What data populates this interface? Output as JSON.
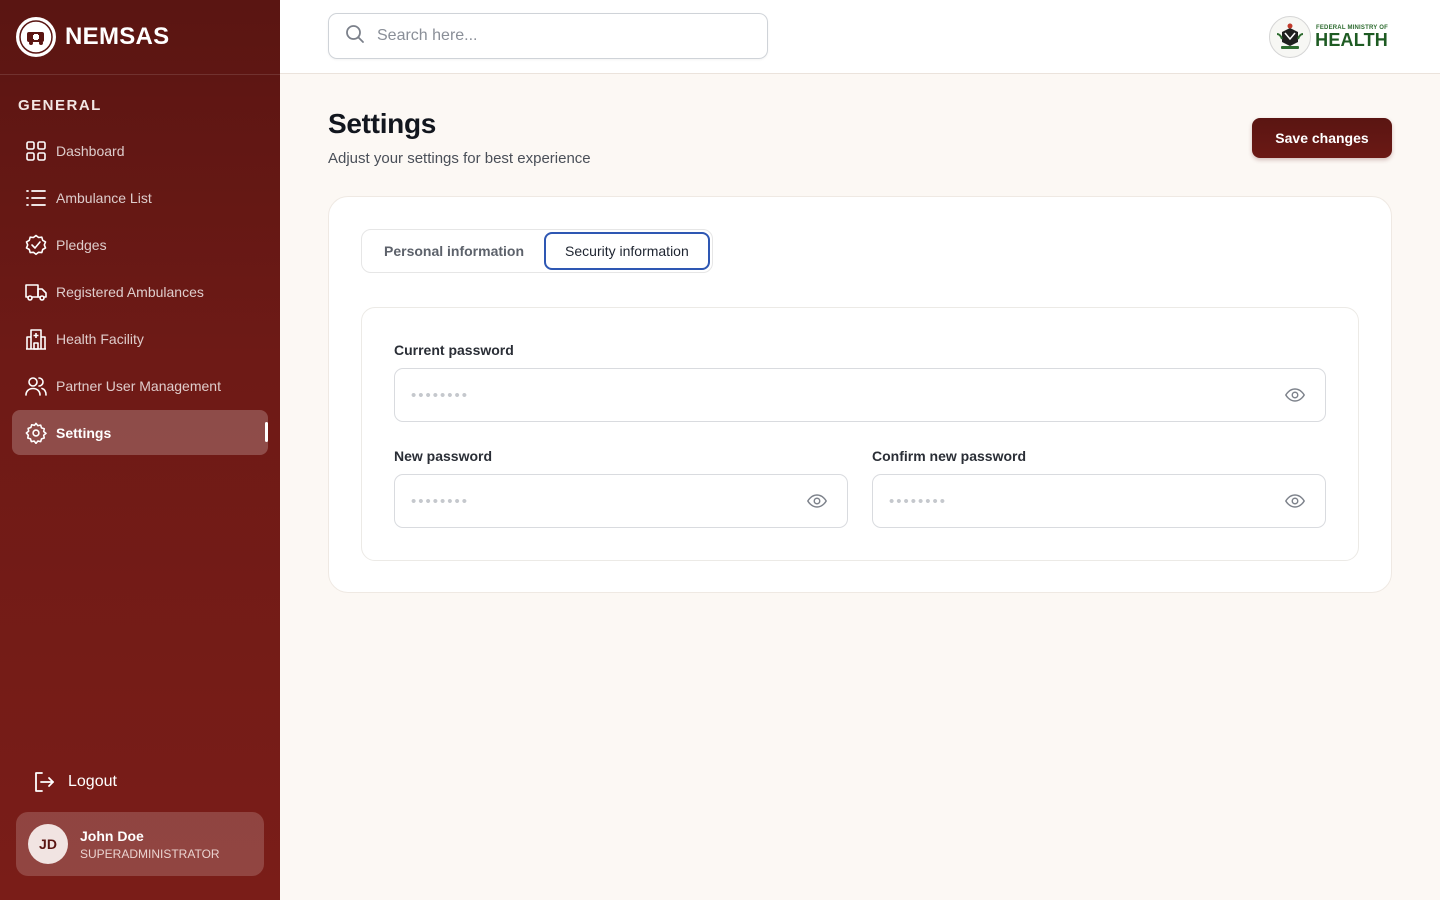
{
  "brand": {
    "name": "NEMSAS",
    "logo_icon": "ambulance-logo-icon",
    "logo_text": "NEMSAS"
  },
  "sidebar": {
    "section_label": "GENERAL",
    "items": [
      {
        "label": "Dashboard",
        "icon": "grid-icon"
      },
      {
        "label": "Ambulance List",
        "icon": "list-icon"
      },
      {
        "label": "Pledges",
        "icon": "badge-check-icon"
      },
      {
        "label": "Registered Ambulances",
        "icon": "truck-icon"
      },
      {
        "label": "Health Facility",
        "icon": "hospital-icon"
      },
      {
        "label": "Partner User Management",
        "icon": "users-icon"
      },
      {
        "label": "Settings",
        "icon": "gear-icon",
        "active": true
      }
    ],
    "logout_label": "Logout"
  },
  "user": {
    "initials": "JD",
    "name": "John Doe",
    "role": "SUPERADMINISTRATOR"
  },
  "header": {
    "search_placeholder": "Search here...",
    "ministry_small": "FEDERAL MINISTRY OF",
    "ministry_big": "HEALTH"
  },
  "page": {
    "title": "Settings",
    "subtitle": "Adjust your settings for best experience",
    "save_label": "Save changes"
  },
  "tabs": [
    {
      "label": "Personal information",
      "active": false
    },
    {
      "label": "Security information",
      "active": true
    }
  ],
  "form": {
    "current_password_label": "Current password",
    "new_password_label": "New password",
    "confirm_password_label": "Confirm new password",
    "password_placeholder": "••••••••"
  },
  "colors": {
    "sidebar_top": "#5a1512",
    "sidebar_bottom": "#7a1d18",
    "accent": "#5a1512",
    "tab_focus": "#2e57b3",
    "page_bg": "#fcf8f4"
  }
}
